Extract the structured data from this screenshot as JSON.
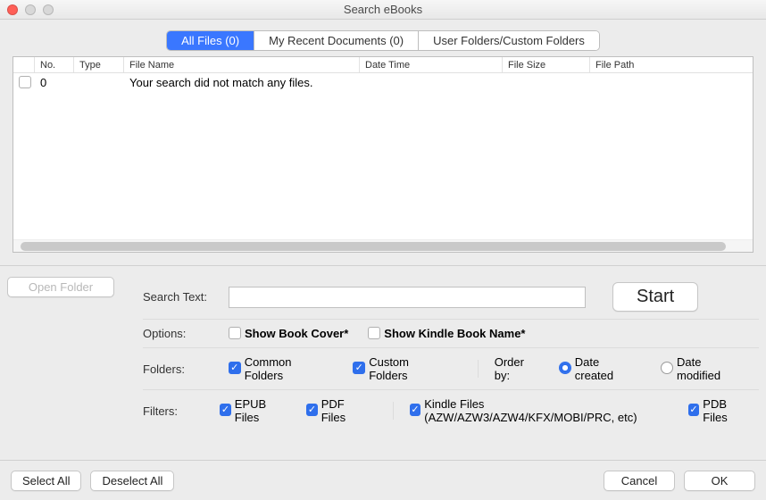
{
  "title": "Search eBooks",
  "tabs": {
    "all": "All Files (0)",
    "recent": "My Recent Documents (0)",
    "user": "User Folders/Custom Folders"
  },
  "columns": {
    "no": "No.",
    "type": "Type",
    "name": "File Name",
    "date": "Date Time",
    "size": "File Size",
    "path": "File Path"
  },
  "rows": [
    {
      "no": "0",
      "name": "Your search did not match any files."
    }
  ],
  "openFolder": "Open Folder",
  "search": {
    "label": "Search Text:",
    "value": "",
    "start": "Start"
  },
  "options": {
    "label": "Options:",
    "showCover": "Show Book Cover*",
    "showKindle": "Show Kindle Book Name*"
  },
  "folders": {
    "label": "Folders:",
    "common": "Common Folders",
    "custom": "Custom Folders",
    "orderby": "Order by:",
    "created": "Date created",
    "modified": "Date modified"
  },
  "filters": {
    "label": "Filters:",
    "epub": "EPUB Files",
    "pdf": "PDF Files",
    "kindle": "Kindle Files (AZW/AZW3/AZW4/KFX/MOBI/PRC, etc)",
    "pdb": "PDB Files"
  },
  "footer": {
    "selectAll": "Select All",
    "deselectAll": "Deselect All",
    "cancel": "Cancel",
    "ok": "OK"
  }
}
